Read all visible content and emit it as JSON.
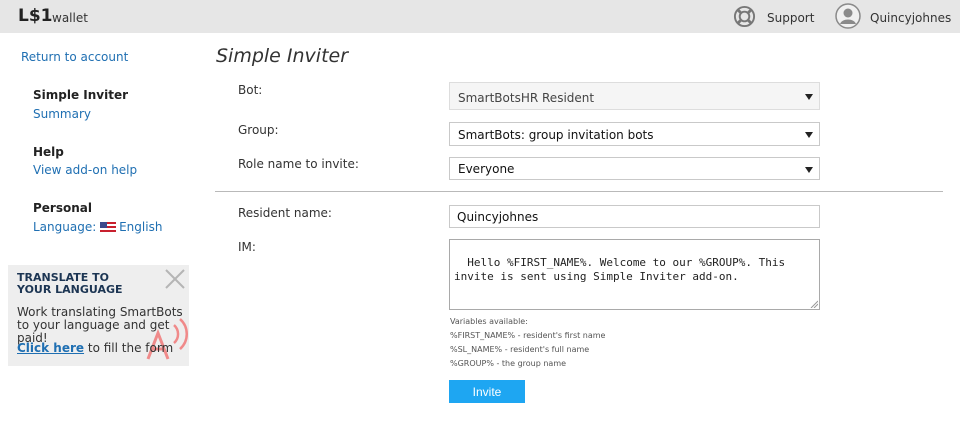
{
  "header": {
    "logo": "L$1",
    "logo_sub": "wallet",
    "support_label": "Support",
    "username": "Quincyjohnes"
  },
  "sidebar": {
    "return_link": "Return to account",
    "section_simple_inviter": {
      "heading": "Simple Inviter",
      "link": "Summary"
    },
    "section_help": {
      "heading": "Help",
      "link": "View add-on help"
    },
    "section_personal": {
      "heading": "Personal",
      "language_prefix": "Language:",
      "language_value": "English"
    }
  },
  "promo": {
    "title": "TRANSLATE TO YOUR LANGUAGE",
    "text": "Work translating SmartBots to your language and get paid!",
    "cta_link": "Click here",
    "cta_rest": " to fill the form"
  },
  "main": {
    "title": "Simple Inviter",
    "bot": {
      "label": "Bot:",
      "value": "SmartBotsHR Resident"
    },
    "group": {
      "label": "Group:",
      "value": "SmartBots: group invitation bots"
    },
    "role": {
      "label": "Role name to invite:",
      "value": "Everyone"
    },
    "resident": {
      "label": "Resident name:",
      "value": "Quincyjohnes"
    },
    "im": {
      "label": "IM:",
      "value": "Hello %FIRST_NAME%. Welcome to our %GROUP%. This invite is sent using Simple Inviter add-on."
    },
    "variables": {
      "heading": "Variables available:",
      "items": [
        "%FIRST_NAME% - resident's first name",
        "%SL_NAME% - resident's full name",
        "%GROUP% - the group name"
      ]
    },
    "invite_button": "Invite"
  },
  "colors": {
    "link": "#1f6fb2",
    "button": "#1ea6f2",
    "topbar": "#e6e6e6"
  }
}
